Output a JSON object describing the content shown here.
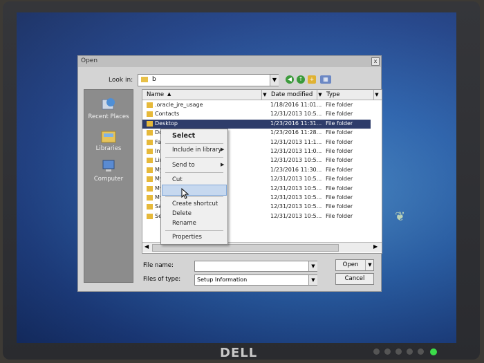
{
  "dialog": {
    "title": "Open",
    "look_in_label": "Look in:",
    "look_in_value": "b"
  },
  "places": [
    {
      "label": "Recent Places",
      "icon": "recent-places-icon"
    },
    {
      "label": "Libraries",
      "icon": "libraries-icon"
    },
    {
      "label": "Computer",
      "icon": "computer-icon"
    }
  ],
  "columns": {
    "name": "Name",
    "date": "Date modified",
    "type": "Type"
  },
  "files": [
    {
      "name": ".oracle_jre_usage",
      "date": "1/18/2016 11:01...",
      "type": "File folder"
    },
    {
      "name": "Contacts",
      "date": "12/31/2013 10:5...",
      "type": "File folder"
    },
    {
      "name": "Desktop",
      "date": "1/23/2016 11:31...",
      "type": "File folder",
      "selected": true
    },
    {
      "name": "Do",
      "date": "1/23/2016 11:28...",
      "type": "File folder"
    },
    {
      "name": "Fav",
      "date": "12/31/2013 11:1...",
      "type": "File folder"
    },
    {
      "name": "Int",
      "date": "12/31/2013 11:0...",
      "type": "File folder"
    },
    {
      "name": "Lin",
      "date": "12/31/2013 10:5...",
      "type": "File folder"
    },
    {
      "name": "My",
      "date": "1/23/2016 11:30...",
      "type": "File folder"
    },
    {
      "name": "My",
      "date": "12/31/2013 10:5...",
      "type": "File folder"
    },
    {
      "name": "My",
      "date": "12/31/2013 10:5...",
      "type": "File folder"
    },
    {
      "name": "My",
      "date": "12/31/2013 10:5...",
      "type": "File folder"
    },
    {
      "name": "Sa",
      "date": "12/31/2013 10:5...",
      "type": "File folder"
    },
    {
      "name": "Se",
      "date": "12/31/2013 10:5...",
      "type": "File folder"
    }
  ],
  "file_name_label": "File name:",
  "file_name_value": "",
  "file_type_label": "Files of type:",
  "file_type_value": "Setup Information",
  "open_label": "Open",
  "cancel_label": "Cancel",
  "context_menu": {
    "select": "Select",
    "include": "Include in library",
    "send_to": "Send to",
    "cut": "Cut",
    "copy": "",
    "create_shortcut": "Create shortcut",
    "delete": "Delete",
    "rename": "Rename",
    "properties": "Properties"
  },
  "monitor_brand": "DELL"
}
